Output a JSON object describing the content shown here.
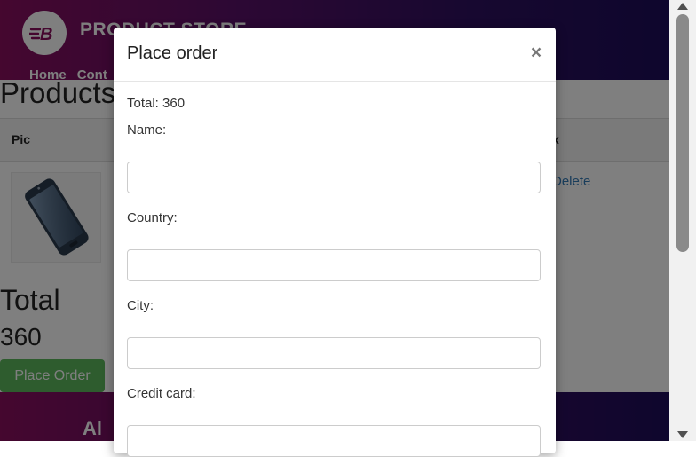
{
  "page": {
    "brand": "PRODUCT STORE",
    "nav": {
      "home": "Home",
      "contact": "Cont"
    },
    "products_title": "Products",
    "table": {
      "col_pic": "Pic",
      "col_x": "x",
      "delete_link": "Delete"
    },
    "total_title": "Total",
    "total_value": "360",
    "place_order_button": "Place Order",
    "footer_text": "Al"
  },
  "modal": {
    "title": "Place order",
    "close_symbol": "×",
    "total_text": "Total: 360",
    "fields": [
      {
        "label": "Name:",
        "value": ""
      },
      {
        "label": "Country:",
        "value": ""
      },
      {
        "label": "City:",
        "value": ""
      },
      {
        "label": "Credit card:",
        "value": ""
      }
    ]
  },
  "colors": {
    "hero_start": "#8a0e5f",
    "hero_end": "#1d0c5a",
    "button_green": "#5cb85c",
    "link_blue": "#337ab7"
  },
  "icons": {
    "logo": "blazedemo-logo-icon",
    "product": "phone-image"
  }
}
